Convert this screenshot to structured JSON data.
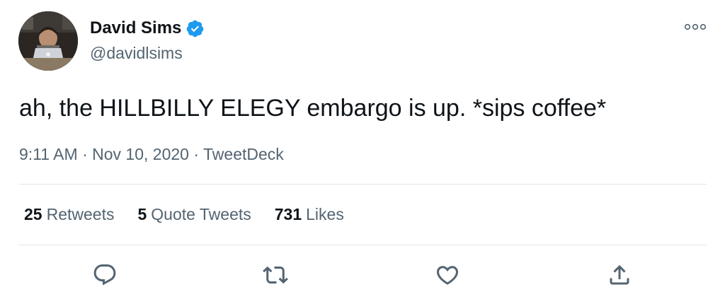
{
  "author": {
    "name": "David Sims",
    "handle": "@davidlsims"
  },
  "tweet": {
    "text": "ah, the HILLBILLY ELEGY embargo is up. *sips coffee*",
    "time": "9:11 AM",
    "date": "Nov 10, 2020",
    "source": "TweetDeck",
    "separator": "·"
  },
  "stats": {
    "retweets_count": "25",
    "retweets_label": "Retweets",
    "quotes_count": "5",
    "quotes_label": "Quote Tweets",
    "likes_count": "731",
    "likes_label": "Likes"
  },
  "icons": {
    "verified": "verified-badge-icon",
    "more": "more-options-icon",
    "reply": "reply-icon",
    "retweet": "retweet-icon",
    "like": "like-icon",
    "share": "share-icon"
  },
  "colors": {
    "verified_blue": "#1d9bf0",
    "secondary_text": "#536471",
    "primary_text": "#0f1419"
  }
}
